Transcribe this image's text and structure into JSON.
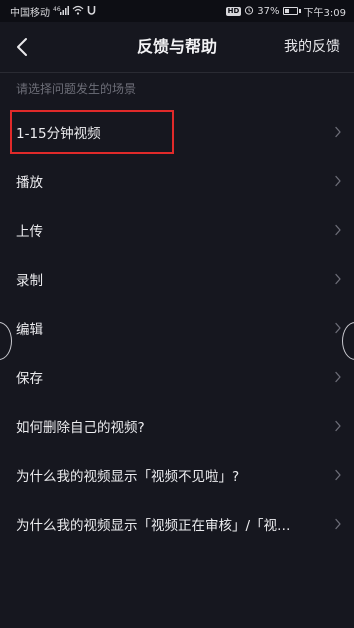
{
  "status_bar": {
    "carrier": "中国移动",
    "hd": "HD",
    "battery_percent": "37%",
    "battery_level": 0.37,
    "time": "下午3:09"
  },
  "nav": {
    "back_icon": "chevron-left-icon",
    "title": "反馈与帮助",
    "feedback_label": "我的反馈"
  },
  "section": {
    "header": "请选择问题发生的场景"
  },
  "items": [
    {
      "label": "1-15分钟视频"
    },
    {
      "label": "播放"
    },
    {
      "label": "上传"
    },
    {
      "label": "录制"
    },
    {
      "label": "编辑"
    },
    {
      "label": "保存"
    },
    {
      "label": "如何删除自己的视频?"
    },
    {
      "label": "为什么我的视频显示「视频不见啦」?"
    },
    {
      "label": "为什么我的视频显示「视频正在审核」/「视…"
    }
  ],
  "colors": {
    "background": "#16171f",
    "highlight": "#e02a2a",
    "muted_text": "#6d6e78"
  }
}
